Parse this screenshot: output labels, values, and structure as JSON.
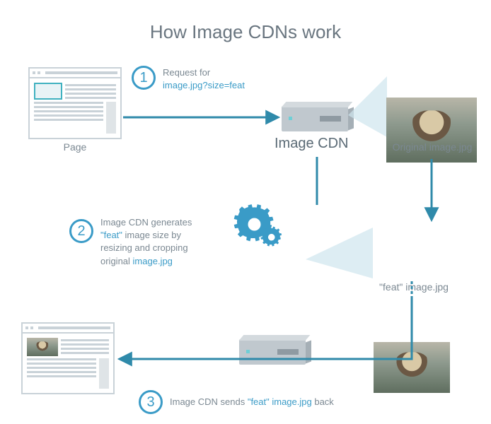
{
  "title": "How Image CDNs work",
  "step1": {
    "number": "1",
    "prefix": "Request for ",
    "code": "image.jpg?size=feat"
  },
  "step2": {
    "number": "2",
    "line1": "Image CDN generates",
    "code1": "\"feat\"",
    "line2_suffix": " image size by",
    "line3": "resizing and cropping",
    "line4_prefix": "original ",
    "code2": "image.jpg"
  },
  "step3": {
    "number": "3",
    "prefix": "Image CDN sends ",
    "code": "\"feat\" image.jpg",
    "suffix": " back"
  },
  "labels": {
    "page": "Page",
    "cdn": "Image CDN",
    "original_prefix": "Original ",
    "original_code": "image.jpg",
    "feat_code": "\"feat\" image.jpg"
  }
}
